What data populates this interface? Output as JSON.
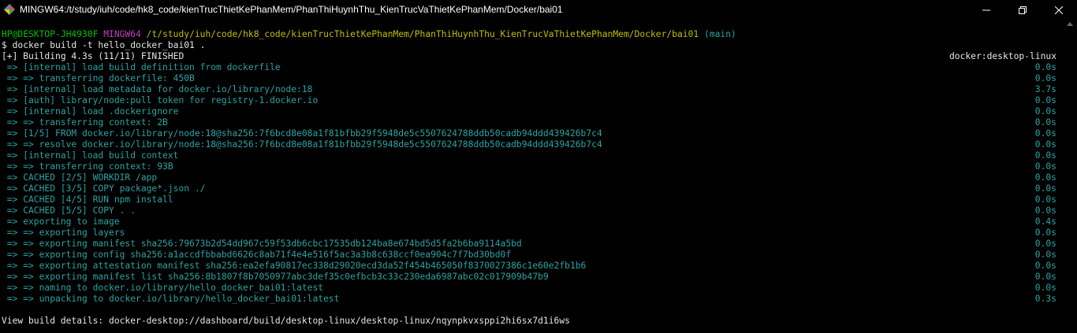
{
  "window": {
    "title": "MINGW64:/t/study/iuh/code/hk8_code/kienTrucThietKePhanMem/PhanThiHuynhThu_KienTrucVaThietKePhanMem/Docker/bai01",
    "icon": "mingw-diamond-icon",
    "controls": [
      "minimize-icon",
      "maximize-icon",
      "close-icon"
    ]
  },
  "colors": {
    "background": "#000000",
    "text": "#c0c0c0",
    "prompt_user": "#00c000",
    "prompt_shell": "#bf40bf",
    "prompt_path": "#bfbf00",
    "prompt_branch": "#2aa3a3",
    "build_step": "#2aa3a3"
  },
  "prompt": {
    "user_host": "HP@DESKTOP-JH4930F",
    "shell": "MINGW64",
    "path": "/t/study/iuh/code/hk8_code/kienTrucThietKePhanMem/PhanThiHuynhThu_KienTrucVaThietKePhanMem/Docker/bai01",
    "branch": "(main)",
    "command": "$ docker build -t hello_docker_bai01 ."
  },
  "build": {
    "header": "[+] Building 4.3s (11/11) FINISHED",
    "context": "docker:desktop-linux",
    "steps": [
      {
        "text": " => [internal] load build definition from dockerfile",
        "time": "0.0s"
      },
      {
        "text": " => => transferring dockerfile: 450B",
        "time": "0.0s"
      },
      {
        "text": " => [internal] load metadata for docker.io/library/node:18",
        "time": "3.7s"
      },
      {
        "text": " => [auth] library/node:pull token for registry-1.docker.io",
        "time": "0.0s"
      },
      {
        "text": " => [internal] load .dockerignore",
        "time": "0.0s"
      },
      {
        "text": " => => transferring context: 2B",
        "time": "0.0s"
      },
      {
        "text": " => [1/5] FROM docker.io/library/node:18@sha256:7f6bcd8e08a1f81bfbb29f5948de5c5507624788ddb50cadb94ddd439426b7c4",
        "time": "0.0s"
      },
      {
        "text": " => => resolve docker.io/library/node:18@sha256:7f6bcd8e08a1f81bfbb29f5948de5c5507624788ddb50cadb94ddd439426b7c4",
        "time": "0.0s"
      },
      {
        "text": " => [internal] load build context",
        "time": "0.0s"
      },
      {
        "text": " => => transferring context: 93B",
        "time": "0.0s"
      },
      {
        "text": " => CACHED [2/5] WORKDIR /app",
        "time": "0.0s"
      },
      {
        "text": " => CACHED [3/5] COPY package*.json ./",
        "time": "0.0s"
      },
      {
        "text": " => CACHED [4/5] RUN npm install",
        "time": "0.0s"
      },
      {
        "text": " => CACHED [5/5] COPY . .",
        "time": "0.0s"
      },
      {
        "text": " => exporting to image",
        "time": "0.4s"
      },
      {
        "text": " => => exporting layers",
        "time": "0.0s"
      },
      {
        "text": " => => exporting manifest sha256:79673b2d54dd967c59f53db6cbc17535db124ba8e674bd5d5fa2b6ba9114a5bd",
        "time": "0.0s"
      },
      {
        "text": " => => exporting config sha256:a1accdfbbabd6626c8ab71f4e4e516f5ac3a3b8c638ccf0ea904c7f7bd30bd0f",
        "time": "0.0s"
      },
      {
        "text": " => => exporting attestation manifest sha256:ea2efa90817ec338d29020ecd3da52f454b465050f8370027386c1e60e2fb1b6",
        "time": "0.0s"
      },
      {
        "text": " => => exporting manifest list sha256:8b1807f8b7050977abc3def35c0efbcb3c33c230eda6987abc02c017909b47b9",
        "time": "0.0s"
      },
      {
        "text": " => => naming to docker.io/library/hello_docker_bai01:latest",
        "time": "0.0s"
      },
      {
        "text": " => => unpacking to docker.io/library/hello_docker_bai01:latest",
        "time": "0.3s"
      }
    ],
    "details": "View build details: docker-desktop://dashboard/build/desktop-linux/desktop-linux/nqynpkvxsppi2hi6sx7d1i6ws"
  }
}
